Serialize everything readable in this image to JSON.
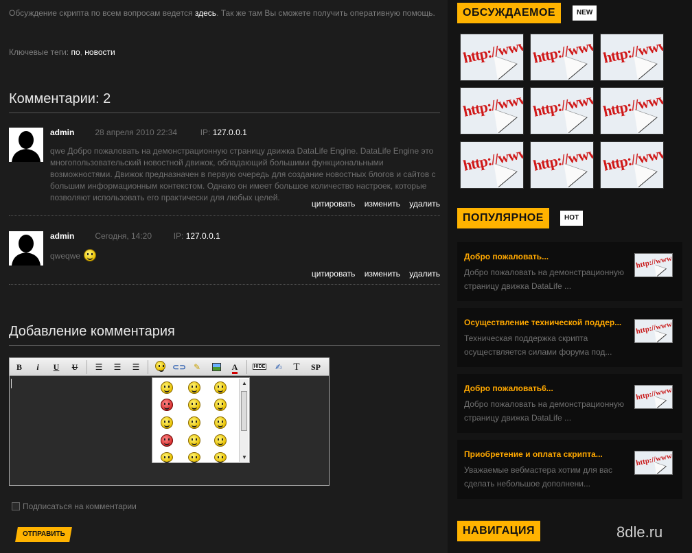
{
  "intro": {
    "text_before": "Обсуждение скрипта по всем вопросам ведется ",
    "link": "здесь",
    "text_after": ". Так же там Вы сможете получить оперативную помощь."
  },
  "tags": {
    "label": "Ключевые теги: ",
    "items": [
      "по",
      "новости"
    ],
    "sep": ", "
  },
  "comments_title": "Комментарии: 2",
  "comments": [
    {
      "author": "admin",
      "date": "28 апреля 2010 22:34",
      "ip_label": "IP:",
      "ip": "127.0.0.1",
      "text": "qwe Добро пожаловать на демонстрационную страницу движка DataLife Engine. DataLife Engine это многопользовательский новостной движок, обладающий большими функциональными возможностями. Движок предназначен в первую очередь для создание новостных блогов и сайтов с большим информационным контекстом. Однако он имеет большое количество настроек, которые позволяют использовать его практически для любых целей."
    },
    {
      "author": "admin",
      "date": "Сегодня, 14:20",
      "ip_label": "IP:",
      "ip": "127.0.0.1",
      "text": "qweqwe"
    }
  ],
  "comment_actions": {
    "quote": "цитировать",
    "edit": "изменить",
    "delete": "удалить"
  },
  "add_comment_title": "Добавление комментария",
  "toolbar": {
    "bold": "B",
    "italic": "i",
    "underline": "U",
    "strike": "U",
    "hide": "HIDE",
    "text": "T",
    "spoiler": "SP"
  },
  "subscribe_label": "Подписаться на комментарии",
  "send_label": "ОТПРАВИТЬ",
  "sidebar": {
    "discussed_title": "ОБСУЖДАЕМОЕ",
    "discussed_badge": "NEW",
    "thumb_text": "http://www",
    "popular_title": "ПОПУЛЯРНОЕ",
    "popular_badge": "HOT",
    "popular": [
      {
        "title": "Добро пожаловать...",
        "desc": "Добро пожаловать на демонстрационную страницу движка DataLife ..."
      },
      {
        "title": "Осуществление технической поддер...",
        "desc": "Техническая поддержка скрипта осуществляется силами форума под..."
      },
      {
        "title": "Добро пожаловать6...",
        "desc": "Добро пожаловать на демонстрационную страницу движка DataLife ..."
      },
      {
        "title": "Приобретение и оплата скрипта...",
        "desc": "Уважаемые вебмастера хотим для вас сделать небольшое дополнени..."
      }
    ],
    "nav_title": "НАВИГАЦИЯ"
  },
  "watermark": "8dle.ru",
  "colors": {
    "accent": "#ffb300",
    "background": "#1c1c1c",
    "link_title": "#ffa800"
  }
}
